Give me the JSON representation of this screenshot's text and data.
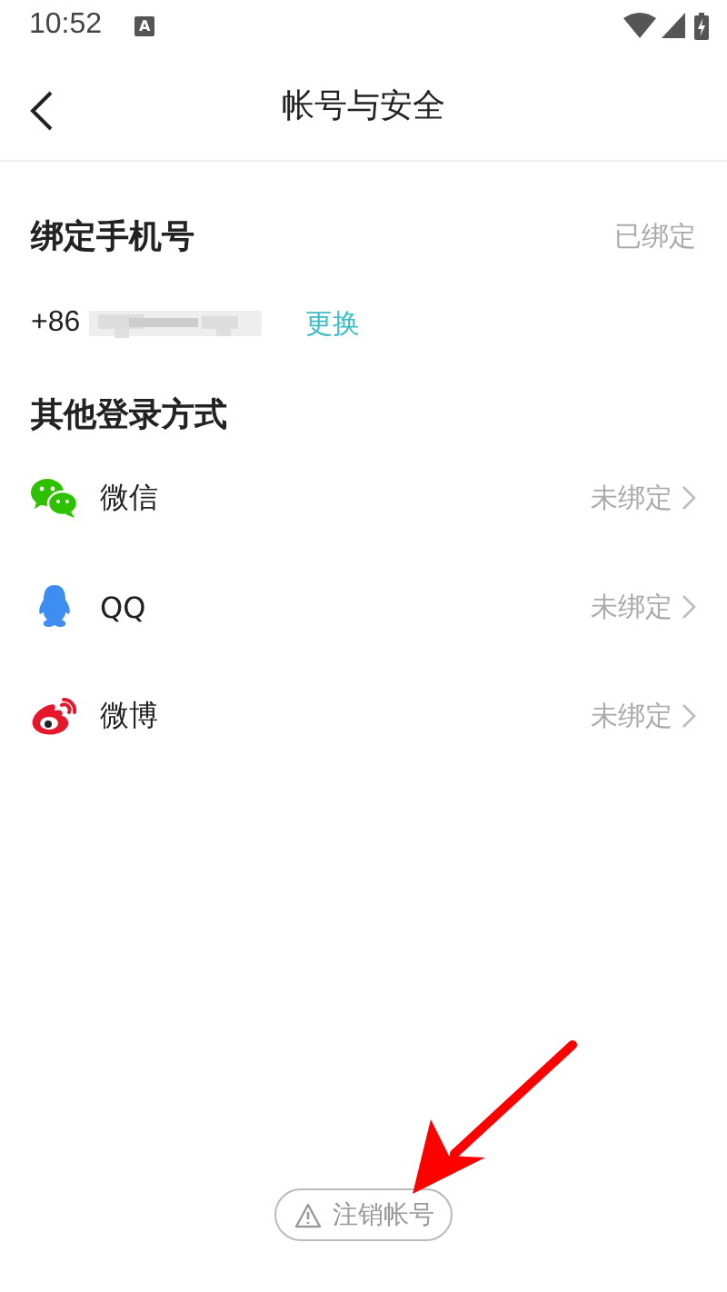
{
  "status_bar": {
    "time": "10:52",
    "notification_badge": "A"
  },
  "header": {
    "title": "帐号与安全"
  },
  "phone_section": {
    "title": "绑定手机号",
    "status": "已绑定",
    "country_code": "+86",
    "change_link": "更换"
  },
  "login_section": {
    "title": "其他登录方式",
    "items": [
      {
        "kind": "wechat",
        "label": "微信",
        "status": "未绑定"
      },
      {
        "kind": "qq",
        "label": "QQ",
        "status": "未绑定"
      },
      {
        "kind": "weibo",
        "label": "微博",
        "status": "未绑定"
      }
    ]
  },
  "delete_button": {
    "label": "注销帐号"
  }
}
